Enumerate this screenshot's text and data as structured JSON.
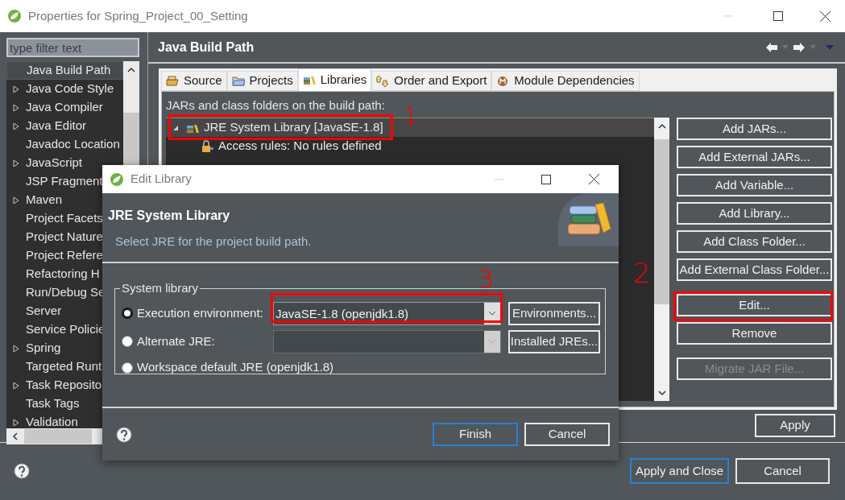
{
  "window": {
    "title": "Properties for Spring_Project_00_Setting"
  },
  "filter": {
    "placeholder": "type filter text"
  },
  "sidebar": {
    "items": [
      {
        "label": "Java Build Path",
        "expandable": false,
        "selected": true
      },
      {
        "label": "Java Code Style",
        "expandable": true,
        "selected": false
      },
      {
        "label": "Java Compiler",
        "expandable": true,
        "selected": false
      },
      {
        "label": "Java Editor",
        "expandable": true,
        "selected": false
      },
      {
        "label": "Javadoc Location",
        "expandable": false,
        "selected": false
      },
      {
        "label": "JavaScript",
        "expandable": true,
        "selected": false
      },
      {
        "label": "JSP Fragment",
        "expandable": false,
        "selected": false
      },
      {
        "label": "Maven",
        "expandable": true,
        "selected": false
      },
      {
        "label": "Project Facets",
        "expandable": false,
        "selected": false
      },
      {
        "label": "Project Nature",
        "expandable": false,
        "selected": false
      },
      {
        "label": "Project Refere",
        "expandable": false,
        "selected": false
      },
      {
        "label": "Refactoring H",
        "expandable": false,
        "selected": false
      },
      {
        "label": "Run/Debug Se",
        "expandable": false,
        "selected": false
      },
      {
        "label": "Server",
        "expandable": false,
        "selected": false
      },
      {
        "label": "Service Policie",
        "expandable": false,
        "selected": false
      },
      {
        "label": "Spring",
        "expandable": true,
        "selected": false
      },
      {
        "label": "Targeted Runt",
        "expandable": false,
        "selected": false
      },
      {
        "label": "Task Reposito",
        "expandable": true,
        "selected": false
      },
      {
        "label": "Task Tags",
        "expandable": false,
        "selected": false
      },
      {
        "label": "Validation",
        "expandable": true,
        "selected": false
      }
    ]
  },
  "page": {
    "title": "Java Build Path"
  },
  "tabs": [
    {
      "label": "Source",
      "kind": "source",
      "selected": false
    },
    {
      "label": "Projects",
      "kind": "projects",
      "selected": false
    },
    {
      "label": "Libraries",
      "kind": "libraries",
      "selected": true
    },
    {
      "label": "Order and Export",
      "kind": "order",
      "selected": false
    },
    {
      "label": "Module Dependencies",
      "kind": "module",
      "selected": false
    }
  ],
  "libraries": {
    "caption": "JARs and class folders on the build path:",
    "tree": [
      {
        "label": "JRE System Library [JavaSE-1.8]",
        "expanded": true,
        "selected": true,
        "children": [
          {
            "label": "Access rules: No rules defined",
            "kind": "rules"
          }
        ]
      }
    ]
  },
  "side_buttons": [
    [
      {
        "label": "Add JARs...",
        "disabled": false
      },
      {
        "label": "Add External JARs...",
        "disabled": false
      },
      {
        "label": "Add Variable...",
        "disabled": false
      },
      {
        "label": "Add Library...",
        "disabled": false
      },
      {
        "label": "Add Class Folder...",
        "disabled": false
      },
      {
        "label": "Add External Class Folder...",
        "disabled": false
      }
    ],
    [
      {
        "label": "Edit...",
        "disabled": false
      },
      {
        "label": "Remove",
        "disabled": false
      }
    ],
    [
      {
        "label": "Migrate JAR File...",
        "disabled": true
      }
    ]
  ],
  "apply_button": "Apply",
  "footer_buttons": [
    {
      "label": "Apply and Close",
      "default": true
    },
    {
      "label": "Cancel",
      "default": false
    }
  ],
  "dialog": {
    "title": "Edit Library",
    "heading": "JRE System Library",
    "description": "Select JRE for the project build path.",
    "group": {
      "label": "System library",
      "options": [
        {
          "kind": "combo",
          "label": "Execution environment:",
          "selected": true,
          "value": "JavaSE-1.8 (openjdk1.8)",
          "disabled": false,
          "button": "Environments..."
        },
        {
          "kind": "combo",
          "label": "Alternate JRE:",
          "selected": false,
          "disabled": true,
          "button": "Installed JREs..."
        },
        {
          "kind": "plain",
          "label": "Workspace default JRE (openjdk1.8)",
          "selected": false
        }
      ]
    },
    "buttons": [
      {
        "label": "Finish",
        "default": true
      },
      {
        "label": "Cancel",
        "default": false
      }
    ]
  },
  "annotations": [
    {
      "label": "1"
    },
    {
      "label": "2"
    },
    {
      "label": "3"
    }
  ]
}
